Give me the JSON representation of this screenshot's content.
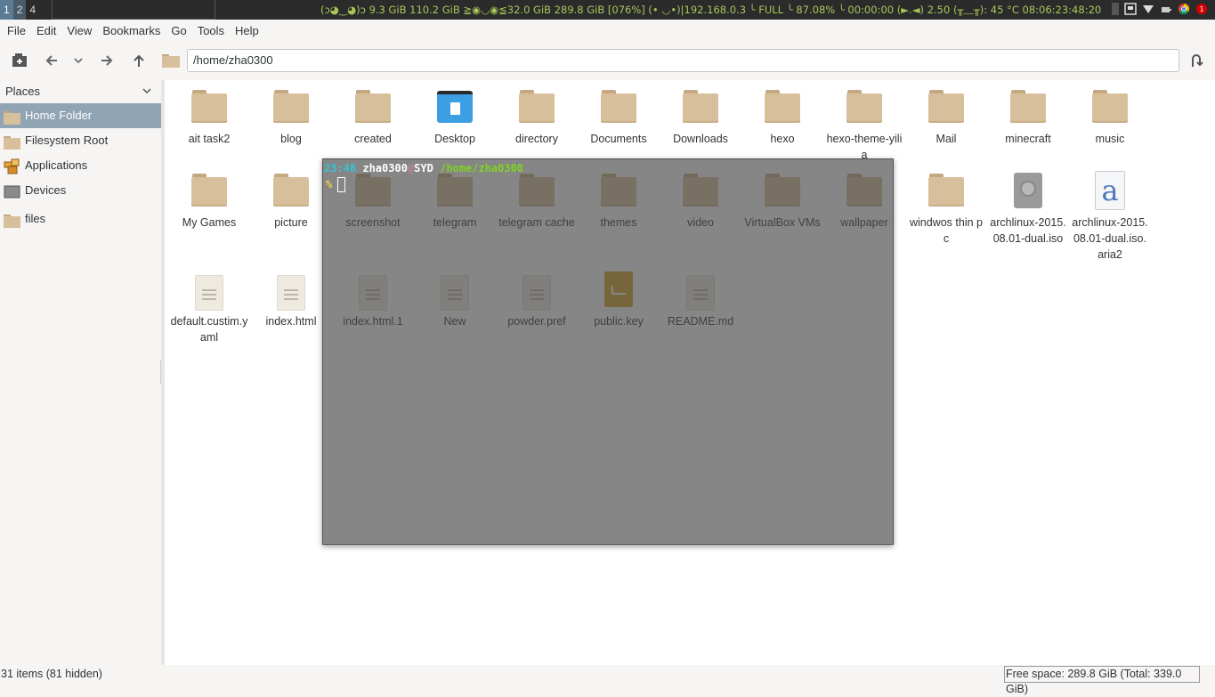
{
  "topbar": {
    "workspaces": [
      "1",
      "2",
      "4"
    ],
    "status_text": "(ↄ◕‿◕)ↄ 9.3 GiB 110.2 GiB   ≧◉◡◉≦32.0 GiB 289.8 GiB   [076%] (• ◡•)|192.168.0.3   ╰ FULL ╰ 87.08% ╰ 00:00:00   (►.◄) 2.50   (╥﹏╥): 45 °C   08:06:23:48:20"
  },
  "menubar": [
    "File",
    "Edit",
    "View",
    "Bookmarks",
    "Go",
    "Tools",
    "Help"
  ],
  "toolbar": {
    "path": "/home/zha0300"
  },
  "sidebar": {
    "header": "Places",
    "items": [
      {
        "label": "Home Folder",
        "icon": "home-folder-icon"
      },
      {
        "label": "Filesystem Root",
        "icon": "folder-icon"
      },
      {
        "label": "Applications",
        "icon": "applications-icon"
      },
      {
        "label": "Devices",
        "icon": "devices-icon"
      },
      {
        "label": "files",
        "icon": "folder-icon"
      }
    ]
  },
  "files": [
    {
      "name": "ait task2",
      "type": "folder"
    },
    {
      "name": "blog",
      "type": "folder"
    },
    {
      "name": "created",
      "type": "folder"
    },
    {
      "name": "Desktop",
      "type": "desktop"
    },
    {
      "name": "directory",
      "type": "folder"
    },
    {
      "name": "Documents",
      "type": "folder"
    },
    {
      "name": "Downloads",
      "type": "folder"
    },
    {
      "name": "hexo",
      "type": "folder"
    },
    {
      "name": "hexo-theme-yilia",
      "type": "folder"
    },
    {
      "name": "Mail",
      "type": "folder"
    },
    {
      "name": "minecraft",
      "type": "folder"
    },
    {
      "name": "music",
      "type": "folder"
    },
    {
      "name": "My Games",
      "type": "folder"
    },
    {
      "name": "picture",
      "type": "folder"
    },
    {
      "name": "screenshot",
      "type": "folder"
    },
    {
      "name": "telegram",
      "type": "folder"
    },
    {
      "name": "telegram cache",
      "type": "folder"
    },
    {
      "name": "themes",
      "type": "folder"
    },
    {
      "name": "video",
      "type": "folder"
    },
    {
      "name": "VirtualBox VMs",
      "type": "folder"
    },
    {
      "name": "wallpaper",
      "type": "folder"
    },
    {
      "name": "windwos thin pc",
      "type": "folder"
    },
    {
      "name": "archlinux-2015.08.01-dual.iso",
      "type": "disc"
    },
    {
      "name": "archlinux-2015.08.01-dual.iso.aria2",
      "type": "aria"
    },
    {
      "name": "default.custim.yaml",
      "type": "doc"
    },
    {
      "name": "index.html",
      "type": "doc"
    },
    {
      "name": "index.html.1",
      "type": "doc"
    },
    {
      "name": "New",
      "type": "doc"
    },
    {
      "name": "powder.pref",
      "type": "doc"
    },
    {
      "name": "public.key",
      "type": "key"
    },
    {
      "name": "README.md",
      "type": "doc"
    }
  ],
  "terminal": {
    "time": "23:48",
    "user": "zha0300",
    "at": "@",
    "host": "SYD",
    "path": "/home/zha0300",
    "prompt": "%"
  },
  "statusbar": {
    "items": "31 items (81 hidden)",
    "free_space": "Free space: 289.8 GiB (Total: 339.0 GiB)"
  }
}
